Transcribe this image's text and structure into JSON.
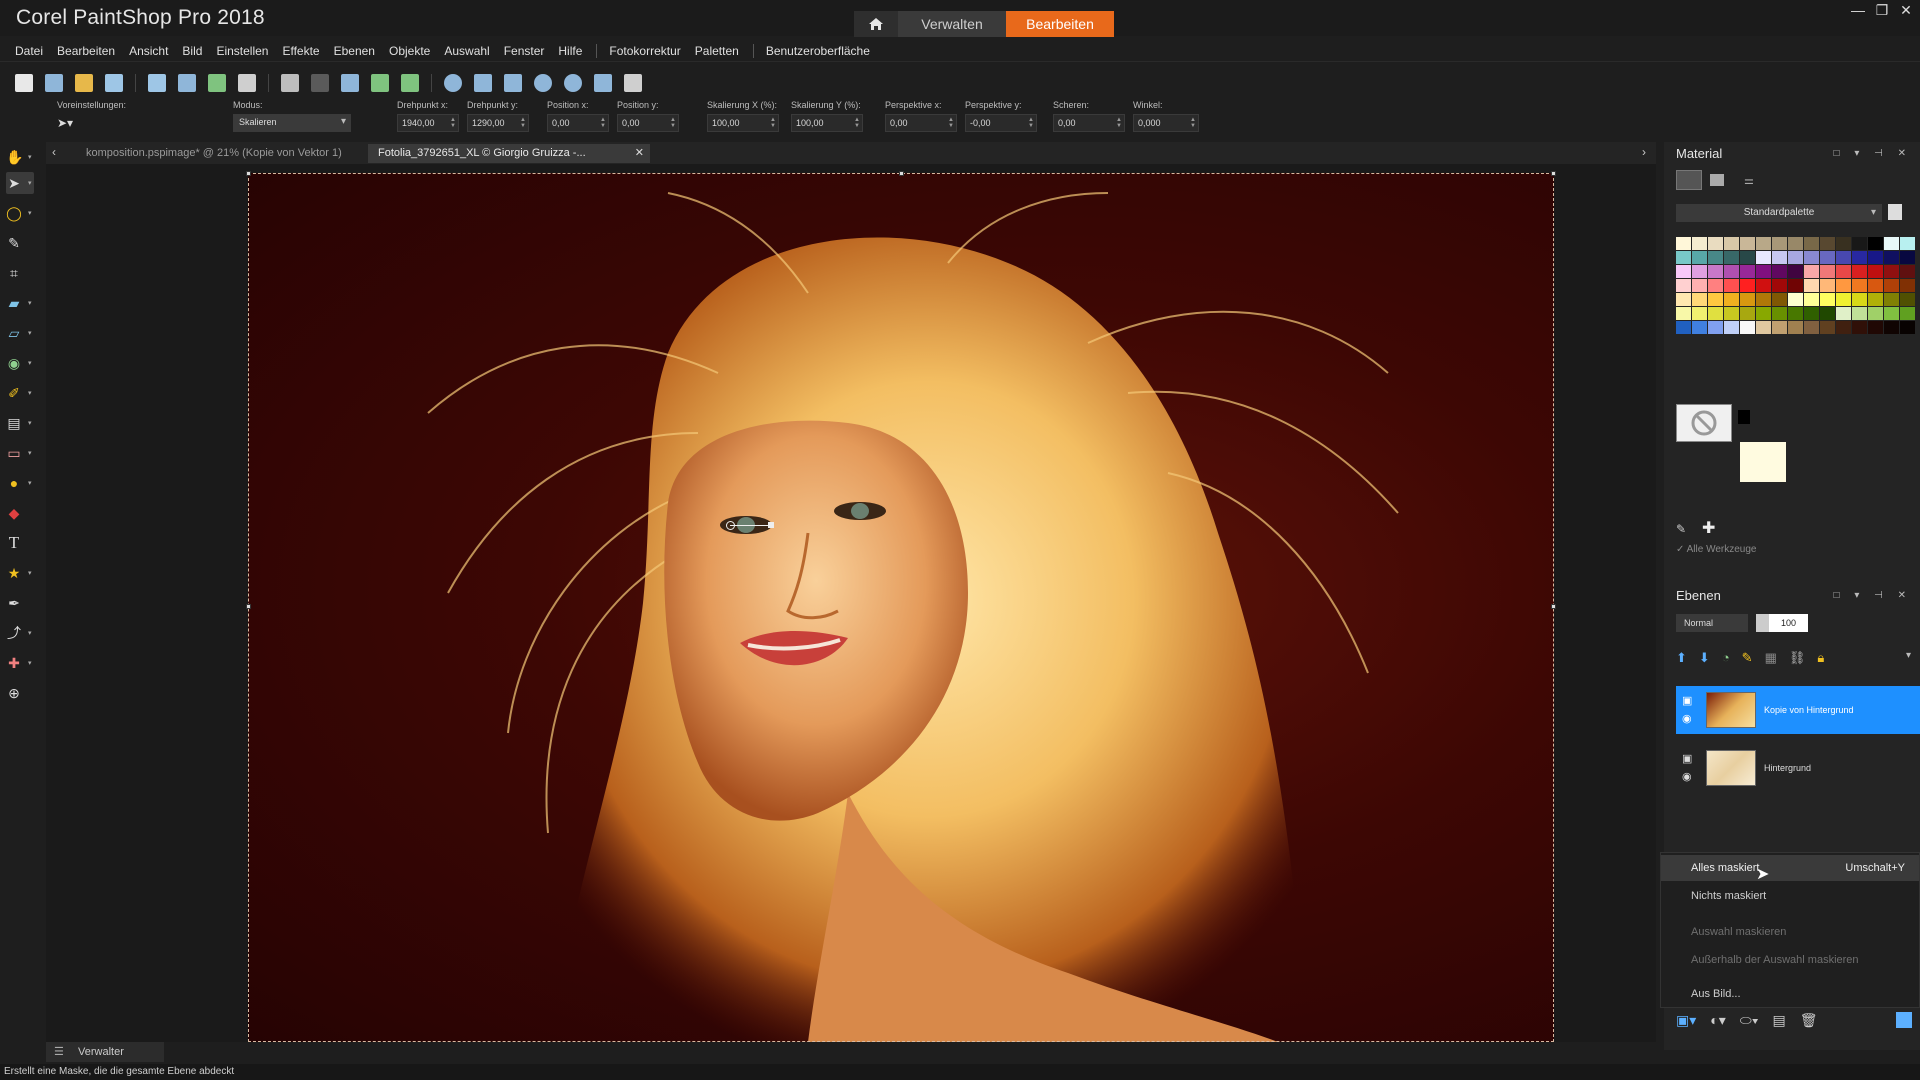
{
  "app": {
    "title": "Corel PaintShop Pro 2018",
    "mode_tabs": {
      "manage": "Verwalten",
      "edit": "Bearbeiten"
    },
    "window_controls": [
      "—",
      "❐",
      "✕"
    ]
  },
  "menu": [
    "Datei",
    "Bearbeiten",
    "Ansicht",
    "Bild",
    "Einstellen",
    "Effekte",
    "Ebenen",
    "Objekte",
    "Auswahl",
    "Fenster",
    "Hilfe",
    "Fotokorrektur",
    "Paletten",
    "Benutzeroberfläche"
  ],
  "options": {
    "presets_label": "Voreinstellungen:",
    "mode_label": "Modus:",
    "mode_value": "Skalieren",
    "pivot_x_label": "Drehpunkt x:",
    "pivot_x_value": "1940,00",
    "pivot_y_label": "Drehpunkt y:",
    "pivot_y_value": "1290,00",
    "pos_x_label": "Position x:",
    "pos_x_value": "0,00",
    "pos_y_label": "Position y:",
    "pos_y_value": "0,00",
    "scale_x_label": "Skalierung X (%):",
    "scale_x_value": "100,00",
    "scale_y_label": "Skalierung Y (%):",
    "scale_y_value": "100,00",
    "persp_x_label": "Perspektive x:",
    "persp_x_value": "0,00",
    "persp_y_label": "Perspektive y:",
    "persp_y_value": "-0,00",
    "shear_label": "Scheren:",
    "shear_value": "0,00",
    "angle_label": "Winkel:",
    "angle_value": "0,000"
  },
  "documents": {
    "tab1": "komposition.pspimage* @  21% (Kopie von Vektor 1)",
    "tab2": "Fotolia_3792651_XL © Giorgio Gruizza -...",
    "close": "✕"
  },
  "material": {
    "title": "Material",
    "palette": "Standardpalette",
    "all_tools": "Alle Werkzeuge"
  },
  "layers": {
    "title": "Ebenen",
    "blend_mode": "Normal",
    "opacity": "100",
    "items": [
      {
        "name": "Kopie von Hintergrund",
        "selected": true
      },
      {
        "name": "Hintergrund",
        "selected": false
      }
    ]
  },
  "context_menu": {
    "items": [
      {
        "label": "Alles maskiert",
        "shortcut": "Umschalt+Y",
        "state": "highlighted"
      },
      {
        "label": "Nichts maskiert",
        "shortcut": "",
        "state": "normal"
      },
      {
        "label": "Auswahl maskieren",
        "shortcut": "",
        "state": "disabled"
      },
      {
        "label": "Außerhalb der Auswahl maskieren",
        "shortcut": "",
        "state": "disabled"
      },
      {
        "label": "Aus Bild...",
        "shortcut": "",
        "state": "normal"
      }
    ]
  },
  "bottom": {
    "organizer_tab": "Verwalter",
    "status": "Erstellt eine Maske, die die gesamte Ebene abdeckt"
  },
  "colors": {
    "accent": "#e8691b",
    "selection": "#1e90ff"
  },
  "swatches": [
    "#fff7d9",
    "#f4ecd0",
    "#e9dcc0",
    "#d8c8a8",
    "#c9b798",
    "#b8a888",
    "#a89878",
    "#988868",
    "#786848",
    "#584830",
    "#383020",
    "#181818",
    "#000000",
    "#e8f8f8",
    "#b8f0f0",
    "#78c8c8",
    "#58a8a8",
    "#488888",
    "#386868",
    "#284848",
    "#e8e8ff",
    "#c8c8f0",
    "#a8a8e0",
    "#8888d0",
    "#6868c0",
    "#4848b0",
    "#2828a0",
    "#181888",
    "#101060",
    "#080840",
    "#f8c8f8",
    "#e0a0e0",
    "#c878c8",
    "#b050b0",
    "#982898",
    "#801080",
    "#600860",
    "#400440",
    "#f8a8a8",
    "#f07878",
    "#e84848",
    "#d82020",
    "#c01010",
    "#901010",
    "#601010",
    "#ffd0d0",
    "#ffb0b0",
    "#ff8080",
    "#ff5050",
    "#ff2020",
    "#d01010",
    "#a00808",
    "#700404",
    "#ffd8b0",
    "#ffb878",
    "#ff9840",
    "#f07820",
    "#d85810",
    "#b04008",
    "#803004",
    "#ffe8b0",
    "#ffd878",
    "#ffc840",
    "#f0b020",
    "#d89810",
    "#b07808",
    "#805804",
    "#ffffd0",
    "#ffff98",
    "#ffff60",
    "#f0f030",
    "#d8d818",
    "#b0b008",
    "#808004",
    "#505002",
    "#f8f8a8",
    "#f0f070",
    "#e0e040",
    "#c8c820",
    "#a8a810",
    "#88a800",
    "#689000",
    "#487800",
    "#306000",
    "#204800",
    "#e0f0c8",
    "#c0e098",
    "#a0d068",
    "#80c040",
    "#60a020",
    "#2060c0",
    "#4080e0",
    "#80a0f0",
    "#c0d0f8",
    "#f8f8f8",
    "#e0c8a0",
    "#c0a070",
    "#a08050",
    "#806040",
    "#604020",
    "#402010",
    "#301008",
    "#200804",
    "#100402",
    "#080201"
  ]
}
